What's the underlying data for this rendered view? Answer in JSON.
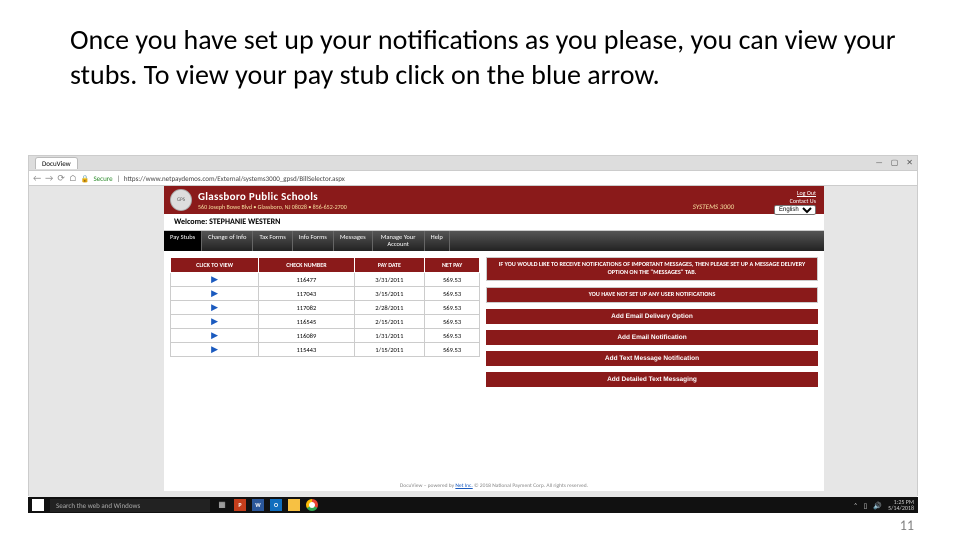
{
  "slide": {
    "instruction": "Once you have set up your notifications as you please, you can view your stubs.  To view your pay stub click on the blue arrow.",
    "page_number": "11"
  },
  "browser": {
    "tab_title": "DocuView",
    "secure_label": "Secure",
    "url": "https://www.netpaydemos.com/External/systems3000_gpsd/BillSelector.aspx",
    "win_min": "—",
    "win_max": "▢",
    "win_close": "✕"
  },
  "header": {
    "org": "Glassboro Public Schools",
    "address": "560 Joseph Bowe Blvd • Glassboro, NJ 08028 • 856-652-2700",
    "brand": "SYSTEMS 3000",
    "logout": "Log Out",
    "contact": "Contact Us",
    "lang_selected": "English"
  },
  "welcome": "Welcome: STEPHANIE WESTERN",
  "menu": {
    "items": [
      "Pay Stubs",
      "Change of Info",
      "Tax Forms",
      "Info Forms",
      "Messages",
      "Manage Your Account",
      "Help"
    ]
  },
  "table": {
    "headers": [
      "CLICK TO VIEW",
      "CHECK NUMBER",
      "PAY DATE",
      "NET PAY"
    ],
    "rows": [
      {
        "check": "116477",
        "date": "3/31/2011",
        "net": "569.53"
      },
      {
        "check": "117043",
        "date": "3/15/2011",
        "net": "569.53"
      },
      {
        "check": "117082",
        "date": "2/28/2011",
        "net": "569.53"
      },
      {
        "check": "116545",
        "date": "2/15/2011",
        "net": "569.53"
      },
      {
        "check": "116089",
        "date": "1/31/2011",
        "net": "569.53"
      },
      {
        "check": "115443",
        "date": "1/15/2011",
        "net": "569.53"
      }
    ]
  },
  "sidebar": {
    "notice": "IF YOU WOULD LIKE TO RECEIVE NOTIFICATIONS OF IMPORTANT MESSAGES, THEN PLEASE SET UP A MESSAGE DELIVERY OPTION ON THE \"MESSAGES\" TAB.",
    "empty": "YOU HAVE NOT SET UP ANY USER NOTIFICATIONS",
    "buttons": [
      "Add Email Delivery Option",
      "Add Email Notification",
      "Add Text Message Notification",
      "Add Detailed Text Messaging"
    ]
  },
  "footer": {
    "text_a": "DocuView – powered by ",
    "link": "Net Inc.",
    "text_b": " © 2018 National Payment Corp. All rights reserved."
  },
  "taskbar": {
    "search_placeholder": "Search the web and Windows",
    "time": "1:25 PM",
    "date": "5/14/2018"
  }
}
